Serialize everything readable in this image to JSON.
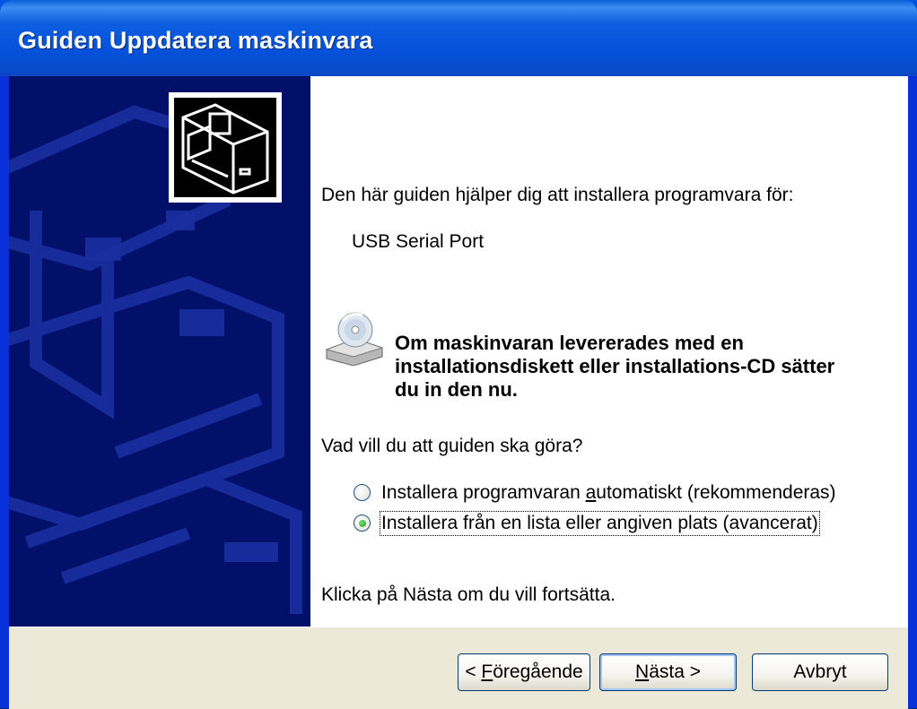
{
  "window": {
    "title": "Guiden Uppdatera maskinvara"
  },
  "content": {
    "intro": "Den här guiden hjälper dig att installera programvara för:",
    "device_name": "USB Serial Port",
    "cd_prompt_line1": "Om maskinvaran levererades med en",
    "cd_prompt_line2": "installationsdiskett eller installations-CD sätter",
    "cd_prompt_line3": "du in den nu.",
    "question": "Vad vill du att guiden ska göra?",
    "options": [
      {
        "label_pre": "Installera programvaran ",
        "label_u": "a",
        "label_post": "utomatiskt (rekommenderas)",
        "selected": false
      },
      {
        "label_pre": "Installera från en lista eller angiven plats (avancerat)",
        "label_u": "",
        "label_post": "",
        "selected": true
      }
    ],
    "footer_hint": "Klicka på Nästa om du vill fortsätta."
  },
  "buttons": {
    "back_pre": "< ",
    "back_u": "F",
    "back_post": "öregående",
    "next_u": "N",
    "next_post": "ästa >",
    "cancel": "Avbryt"
  },
  "icons": {
    "hardware": "hardware-box-icon",
    "cd": "cd-drive-icon"
  },
  "colors": {
    "titlebar": "#0054e3",
    "side_panel": "#02106a",
    "button_bar": "#ece9d8"
  }
}
